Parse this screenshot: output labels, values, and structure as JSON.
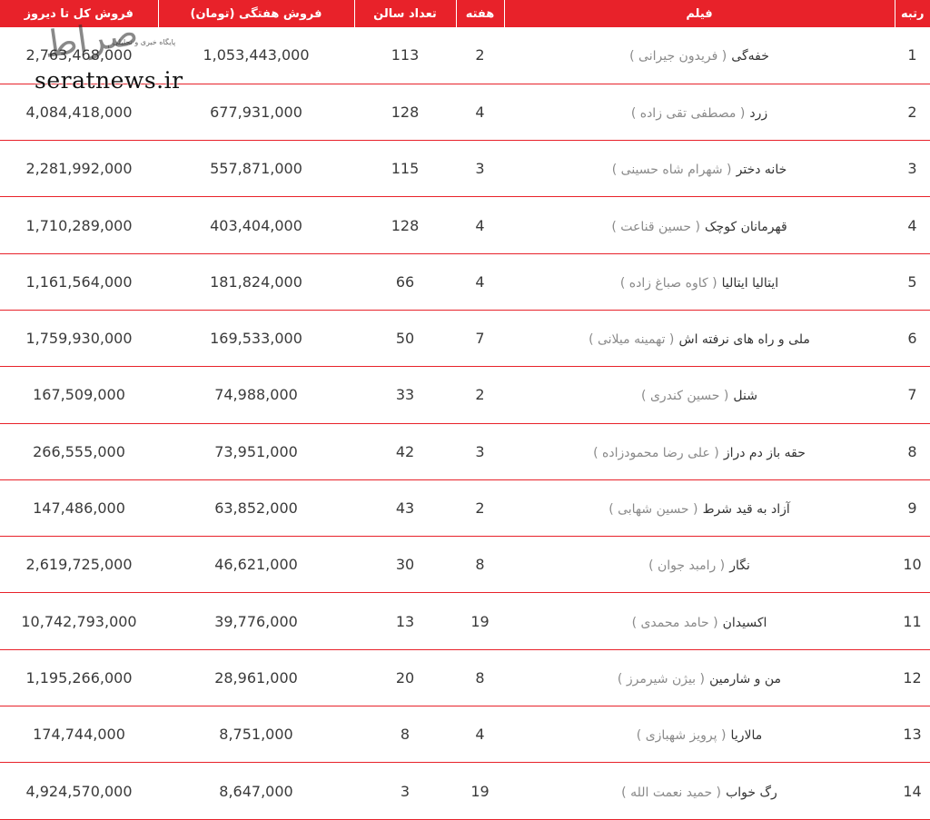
{
  "table": {
    "headers": {
      "rank": "رتبه",
      "film": "فیلم",
      "week": "هفته",
      "halls": "تعداد سالن",
      "weekly_sales": "فروش هفتگی (تومان)",
      "total_sales": "فروش کل تا دیروز"
    },
    "rows": [
      {
        "rank": "1",
        "title": "خفه‌گی",
        "director": "( فریدون جیرانی )",
        "week": "2",
        "halls": "113",
        "weekly": "1,053,443,000",
        "total": "2,763,468,000"
      },
      {
        "rank": "2",
        "title": "زرد",
        "director": "( مصطفی تقی زاده )",
        "week": "4",
        "halls": "128",
        "weekly": "677,931,000",
        "total": "4,084,418,000"
      },
      {
        "rank": "3",
        "title": "خانه دختر",
        "director": "( شهرام شاه حسینی )",
        "week": "3",
        "halls": "115",
        "weekly": "557,871,000",
        "total": "2,281,992,000"
      },
      {
        "rank": "4",
        "title": "قهرمانان کوچک",
        "director": "( حسین قناعت )",
        "week": "4",
        "halls": "128",
        "weekly": "403,404,000",
        "total": "1,710,289,000"
      },
      {
        "rank": "5",
        "title": "ایتالیا ایتالیا",
        "director": "( کاوه صباغ زاده )",
        "week": "4",
        "halls": "66",
        "weekly": "181,824,000",
        "total": "1,161,564,000"
      },
      {
        "rank": "6",
        "title": "ملی و راه های نرفته اش",
        "director": "( تهمینه میلانی )",
        "week": "7",
        "halls": "50",
        "weekly": "169,533,000",
        "total": "1,759,930,000"
      },
      {
        "rank": "7",
        "title": "شنل",
        "director": "( حسین کندری )",
        "week": "2",
        "halls": "33",
        "weekly": "74,988,000",
        "total": "167,509,000"
      },
      {
        "rank": "8",
        "title": "حقه باز دم دراز",
        "director": "( علی رضا محمودزاده )",
        "week": "3",
        "halls": "42",
        "weekly": "73,951,000",
        "total": "266,555,000"
      },
      {
        "rank": "9",
        "title": "آزاد به قید شرط",
        "director": "( حسین شهابی )",
        "week": "2",
        "halls": "43",
        "weekly": "63,852,000",
        "total": "147,486,000"
      },
      {
        "rank": "10",
        "title": "نگار",
        "director": "( رامبد جوان )",
        "week": "8",
        "halls": "30",
        "weekly": "46,621,000",
        "total": "2,619,725,000"
      },
      {
        "rank": "11",
        "title": "اکسیدان",
        "director": "( حامد محمدی )",
        "week": "19",
        "halls": "13",
        "weekly": "39,776,000",
        "total": "10,742,793,000"
      },
      {
        "rank": "12",
        "title": "من و شارمین",
        "director": "( بیژن شیرمرز )",
        "week": "8",
        "halls": "20",
        "weekly": "28,961,000",
        "total": "1,195,266,000"
      },
      {
        "rank": "13",
        "title": "مالاریا",
        "director": "( پرویز شهبازی )",
        "week": "4",
        "halls": "8",
        "weekly": "8,751,000",
        "total": "174,744,000"
      },
      {
        "rank": "14",
        "title": "رگ خواب",
        "director": "( حمید نعمت الله )",
        "week": "19",
        "halls": "3",
        "weekly": "8,647,000",
        "total": "4,924,570,000"
      }
    ]
  },
  "watermark": {
    "script": "صراط",
    "tagline": "پایگاه خبری و تحلیلی",
    "domain": "seratnews.ir"
  },
  "colors": {
    "accent": "#e8222a",
    "header_text": "#ffffff",
    "director_text": "#8a8a8a"
  }
}
